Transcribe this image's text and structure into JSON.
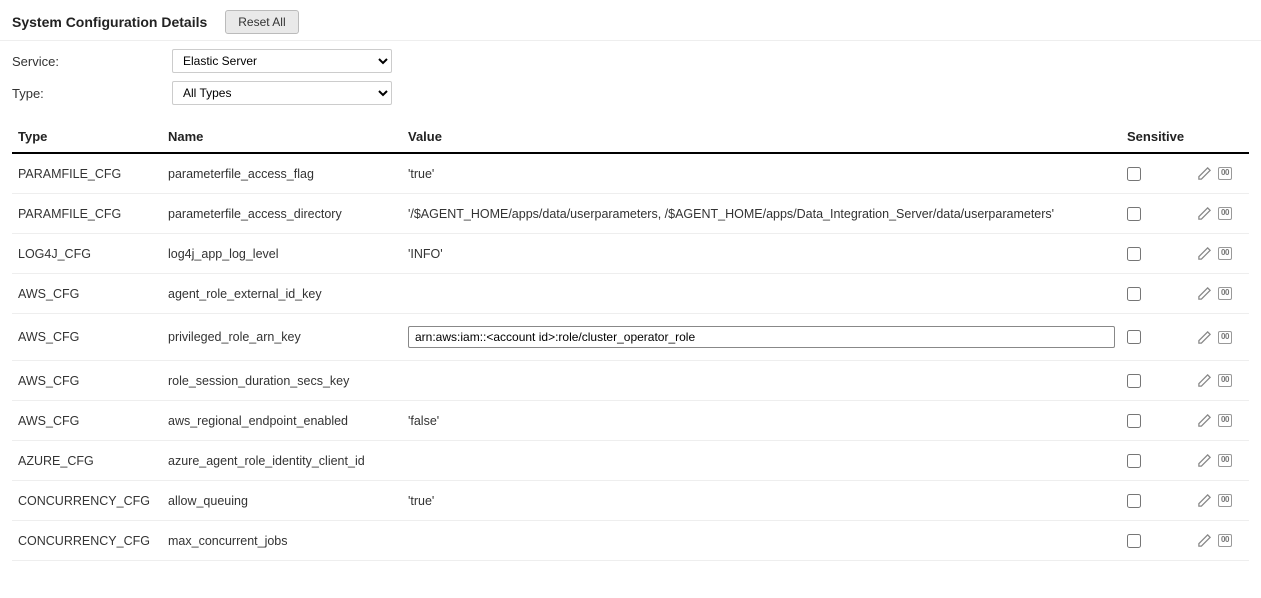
{
  "header": {
    "title": "System Configuration Details",
    "reset_button": "Reset All"
  },
  "filters": {
    "service_label": "Service:",
    "service_value": "Elastic Server",
    "type_label": "Type:",
    "type_value": "All Types"
  },
  "columns": {
    "type": "Type",
    "name": "Name",
    "value": "Value",
    "sensitive": "Sensitive"
  },
  "rows": [
    {
      "type": "PARAMFILE_CFG",
      "name": "parameterfile_access_flag",
      "value": "'true'",
      "editing": false,
      "sensitive": false
    },
    {
      "type": "PARAMFILE_CFG",
      "name": "parameterfile_access_directory",
      "value": "'/$AGENT_HOME/apps/data/userparameters, /$AGENT_HOME/apps/Data_Integration_Server/data/userparameters'",
      "editing": false,
      "sensitive": false
    },
    {
      "type": "LOG4J_CFG",
      "name": "log4j_app_log_level",
      "value": "'INFO'",
      "editing": false,
      "sensitive": false
    },
    {
      "type": "AWS_CFG",
      "name": "agent_role_external_id_key",
      "value": "",
      "editing": false,
      "sensitive": false
    },
    {
      "type": "AWS_CFG",
      "name": "privileged_role_arn_key",
      "value": "arn:aws:iam::<account id>:role/cluster_operator_role",
      "editing": true,
      "sensitive": false
    },
    {
      "type": "AWS_CFG",
      "name": "role_session_duration_secs_key",
      "value": "",
      "editing": false,
      "sensitive": false
    },
    {
      "type": "AWS_CFG",
      "name": "aws_regional_endpoint_enabled",
      "value": "'false'",
      "editing": false,
      "sensitive": false
    },
    {
      "type": "AZURE_CFG",
      "name": "azure_agent_role_identity_client_id",
      "value": "",
      "editing": false,
      "sensitive": false
    },
    {
      "type": "CONCURRENCY_CFG",
      "name": "allow_queuing",
      "value": "'true'",
      "editing": false,
      "sensitive": false
    },
    {
      "type": "CONCURRENCY_CFG",
      "name": "max_concurrent_jobs",
      "value": "",
      "editing": false,
      "sensitive": false
    }
  ],
  "icons": {
    "edit": "edit-icon",
    "tag": "tag-icon"
  }
}
